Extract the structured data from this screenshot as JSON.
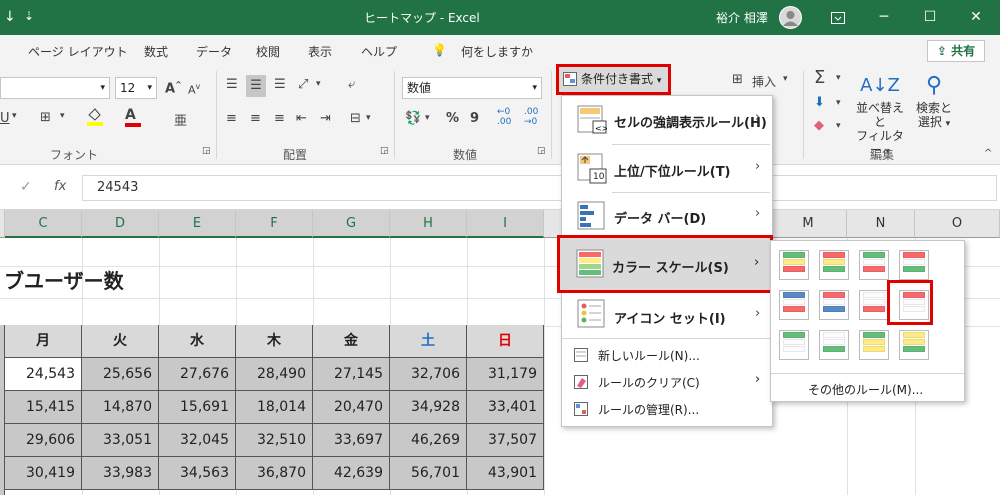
{
  "titlebar": {
    "quick_access": "↓",
    "quick_access_more": "⇣",
    "title": "ヒートマップ  -  Excel",
    "user": "裕介 相澤",
    "window_controls": [
      "ribbon-display-icon",
      "minimize-icon",
      "maximize-icon",
      "close-icon"
    ]
  },
  "menu": {
    "tabs": [
      "ページ レイアウト",
      "数式",
      "データ",
      "校閲",
      "表示",
      "ヘルプ"
    ],
    "search_placeholder": "何をしますか",
    "share": "共有"
  },
  "ribbon": {
    "font_size": "12",
    "font_group": "フォント",
    "align_group": "配置",
    "number_format": "数値",
    "number_group": "数値",
    "conditional_format": "条件付き書式",
    "insert": "挿入",
    "sort_filter_line1": "並べ替えと",
    "sort_filter_line2": "フィルター",
    "find_select_line1": "検索と",
    "find_select_line2": "選択",
    "edit_group": "編集",
    "percent": "%",
    "comma": "9",
    "inc_decimal": ".00",
    "dec_decimal": ".00",
    "font_color_label": "A",
    "grow_font": "A",
    "shrink_font": "A"
  },
  "formula_bar": {
    "fx": "fx",
    "value": "24543"
  },
  "grid": {
    "columns": [
      "C",
      "D",
      "E",
      "F",
      "G",
      "H",
      "I",
      "M",
      "N",
      "O"
    ],
    "title": "ブユーザー数",
    "headers": [
      "月",
      "火",
      "水",
      "木",
      "金",
      "土",
      "日"
    ],
    "rows": [
      [
        "24,543",
        "25,656",
        "27,676",
        "28,490",
        "27,145",
        "32,706",
        "31,179"
      ],
      [
        "15,415",
        "14,870",
        "15,691",
        "18,014",
        "20,470",
        "34,928",
        "33,401"
      ],
      [
        "29,606",
        "33,051",
        "32,045",
        "32,510",
        "33,697",
        "46,269",
        "37,507"
      ],
      [
        "30,419",
        "33,983",
        "34,563",
        "36,870",
        "42,639",
        "56,701",
        "43,901"
      ]
    ],
    "header_colors": {
      "sat": "#1f6fc5",
      "sun": "#e00000"
    }
  },
  "cf_menu": {
    "items": [
      {
        "label": "セルの強調表示ルール(H)"
      },
      {
        "label": "上位/下位ルール(T)",
        "icon_text": "10"
      },
      {
        "label": "データ バー(D)"
      },
      {
        "label": "カラー スケール(S)"
      },
      {
        "label": "アイコン セット(I)"
      }
    ],
    "simple_items": [
      "新しいルール(N)...",
      "ルールのクリア(C)",
      "ルールの管理(R)..."
    ]
  },
  "color_scale": {
    "swatches": [
      [
        "#63be7b",
        "#ffeb84",
        "#f8696b"
      ],
      [
        "#f8696b",
        "#ffeb84",
        "#63be7b"
      ],
      [
        "#63be7b",
        "#fcfcff",
        "#f8696b"
      ],
      [
        "#f8696b",
        "#fcfcff",
        "#63be7b"
      ],
      [
        "#5a8ac6",
        "#fcfcff",
        "#f8696b"
      ],
      [
        "#f8696b",
        "#fcfcff",
        "#5a8ac6"
      ],
      [
        "#fcfcff",
        "#fcfcff",
        "#f8696b"
      ],
      [
        "#f8696b",
        "#fcfcff",
        "#fcfcff"
      ],
      [
        "#63be7b",
        "#fcfcff",
        "#fcfcff"
      ],
      [
        "#fcfcff",
        "#fcfcff",
        "#63be7b"
      ],
      [
        "#63be7b",
        "#ffeb84",
        "#ffeb84"
      ],
      [
        "#ffeb84",
        "#ffeb84",
        "#63be7b"
      ]
    ],
    "more_rules": "その他のルール(M)..."
  }
}
